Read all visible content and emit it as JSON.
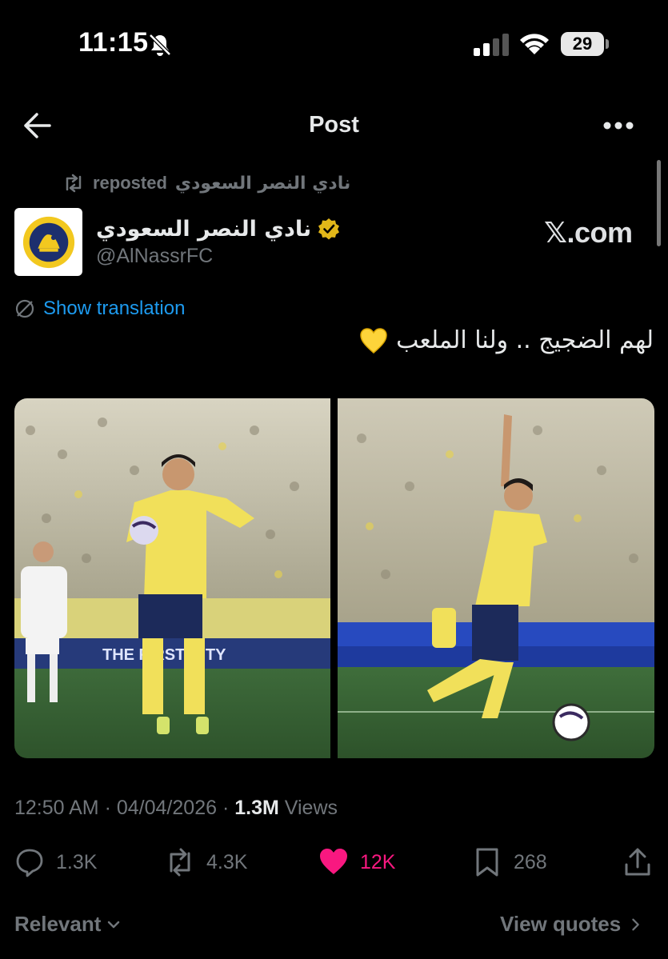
{
  "status_bar": {
    "time": "11:15",
    "battery": "29",
    "icons": [
      "bell-slash-icon",
      "cellular-signal-icon",
      "wifi-icon",
      "battery-icon"
    ]
  },
  "header": {
    "title": "Post",
    "back_icon": "arrow-left-icon",
    "more_icon": "ellipsis-icon"
  },
  "repost": {
    "label": "reposted",
    "reposter": "نادي النصر السعودي"
  },
  "author": {
    "display_name": "نادي النصر السعودي",
    "handle": "@AlNassrFC",
    "verified_color": "#e2b719"
  },
  "watermark": "𝕏.com",
  "translation_link": "Show translation",
  "tweet_text": "لهم الضجيج .. ولنا الملعب",
  "tweet_emoji": "yellow-heart-icon",
  "meta": {
    "time": "12:50 AM",
    "date": "04/04/2026",
    "views_count": "1.3M",
    "views_label": "Views"
  },
  "actions": {
    "replies": "1.3K",
    "reposts": "4.3K",
    "likes": "12K",
    "bookmarks": "268"
  },
  "footer": {
    "sort": "Relevant",
    "quotes": "View quotes"
  },
  "colors": {
    "accent_blue": "#1d9bf0",
    "like_pink": "#f91880",
    "muted": "#71767b",
    "kit_yellow": "#f4e25a",
    "kit_navy": "#1c2a5a"
  }
}
